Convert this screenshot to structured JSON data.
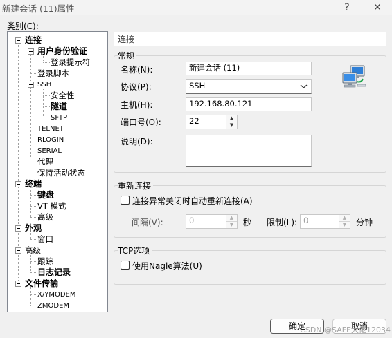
{
  "window": {
    "title": "新建会话 (11)属性",
    "help_glyph": "?",
    "close_glyph": "✕"
  },
  "category_label": "类别(C):",
  "tree": {
    "connect": "连接",
    "user_auth": "用户身份验证",
    "login_prompt": "登录提示符",
    "login_script": "登录脚本",
    "ssh": "SSH",
    "security": "安全性",
    "tunnel": "隧道",
    "sftp": "SFTP",
    "telnet": "TELNET",
    "rlogin": "RLOGIN",
    "serial": "SERIAL",
    "proxy": "代理",
    "keepalive": "保持活动状态",
    "terminal": "终端",
    "keyboard": "键盘",
    "vt_mode": "VT 模式",
    "advanced": "高级",
    "appearance": "外观",
    "window": "窗口",
    "advanced2": "高级",
    "trace": "跟踪",
    "log": "日志记录",
    "file_transfer": "文件传输",
    "xymodem": "X/YMODEM",
    "zmodem": "ZMODEM"
  },
  "panel": {
    "title": "连接",
    "general": {
      "group_title": "常规",
      "name_label": "名称(N):",
      "name_value": "新建会话 (11)",
      "protocol_label": "协议(P):",
      "protocol_value": "SSH",
      "host_label": "主机(H):",
      "host_value": "192.168.80.121",
      "port_label": "端口号(O):",
      "port_value": "22",
      "desc_label": "说明(D):",
      "desc_value": ""
    },
    "reconnect": {
      "group_title": "重新连接",
      "checkbox_label": "连接异常关闭时自动重新连接(A)",
      "checked": false,
      "interval_label": "间隔(V):",
      "interval_value": "0",
      "interval_unit": "秒",
      "limit_label": "限制(L):",
      "limit_value": "0",
      "limit_unit": "分钟"
    },
    "tcp": {
      "group_title": "TCP选项",
      "nagle_label": "使用Nagle算法(U)",
      "checked": false
    }
  },
  "buttons": {
    "ok": "确定",
    "cancel": "取消"
  },
  "watermark": "CSDN @SAFE大佬12034",
  "icons": [
    "help-icon",
    "close-icon",
    "network-computers-icon",
    "chevron-down-icon",
    "spin-up-icon",
    "spin-down-icon"
  ]
}
